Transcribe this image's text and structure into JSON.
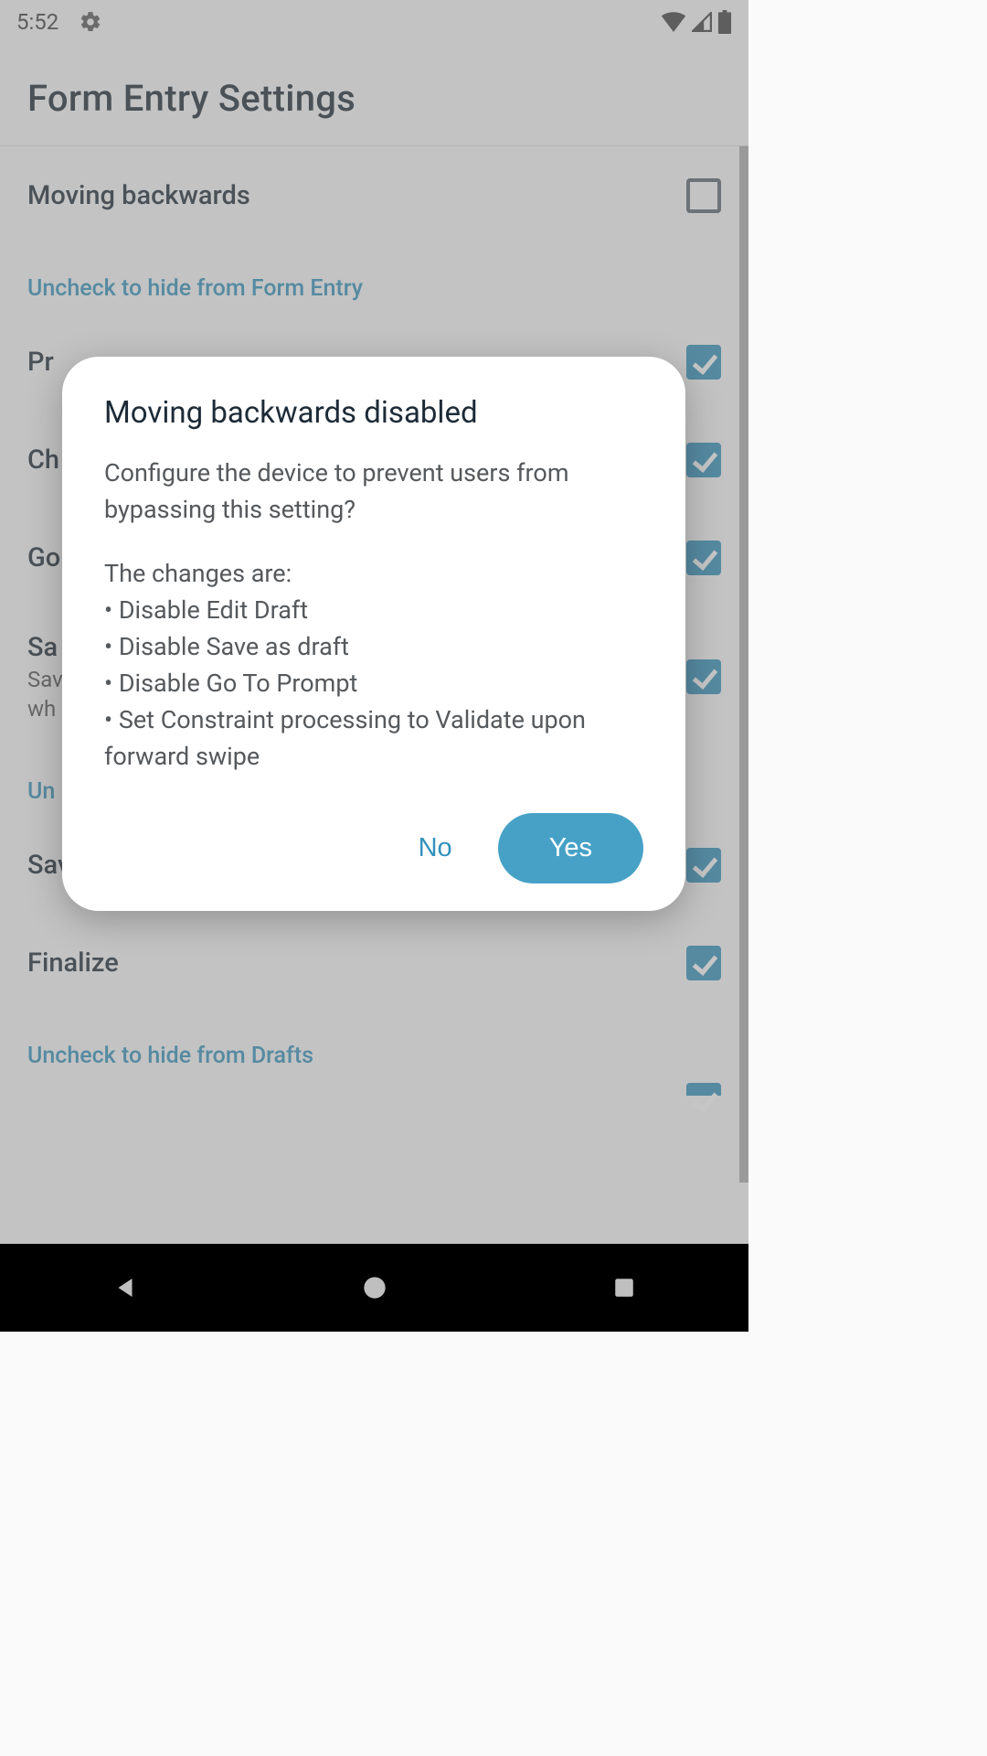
{
  "status": {
    "time": "5:52"
  },
  "page": {
    "title": "Form Entry Settings"
  },
  "sections": {
    "top_item": {
      "title": "Moving backwards"
    },
    "header1": "Uncheck to hide from Form Entry",
    "h1_items": [
      {
        "title": "Pr"
      },
      {
        "title": "Ch"
      },
      {
        "title": "Go"
      },
      {
        "title": "Sa",
        "sub1": "Sav",
        "sub2": "wh"
      }
    ],
    "header2_short": "Un",
    "h2_items": [
      {
        "title": "Save as draft"
      },
      {
        "title": "Finalize"
      }
    ],
    "header3": "Uncheck to hide from Drafts"
  },
  "dialog": {
    "title": "Moving backwards disabled",
    "para1": "Configure the device to prevent users from bypassing this setting?",
    "para2": "The changes are:",
    "bullets": [
      "Disable Edit Draft",
      "Disable Save as draft",
      "Disable Go To Prompt",
      "Set Constraint processing to Validate upon forward swipe"
    ],
    "no": "No",
    "yes": "Yes"
  }
}
